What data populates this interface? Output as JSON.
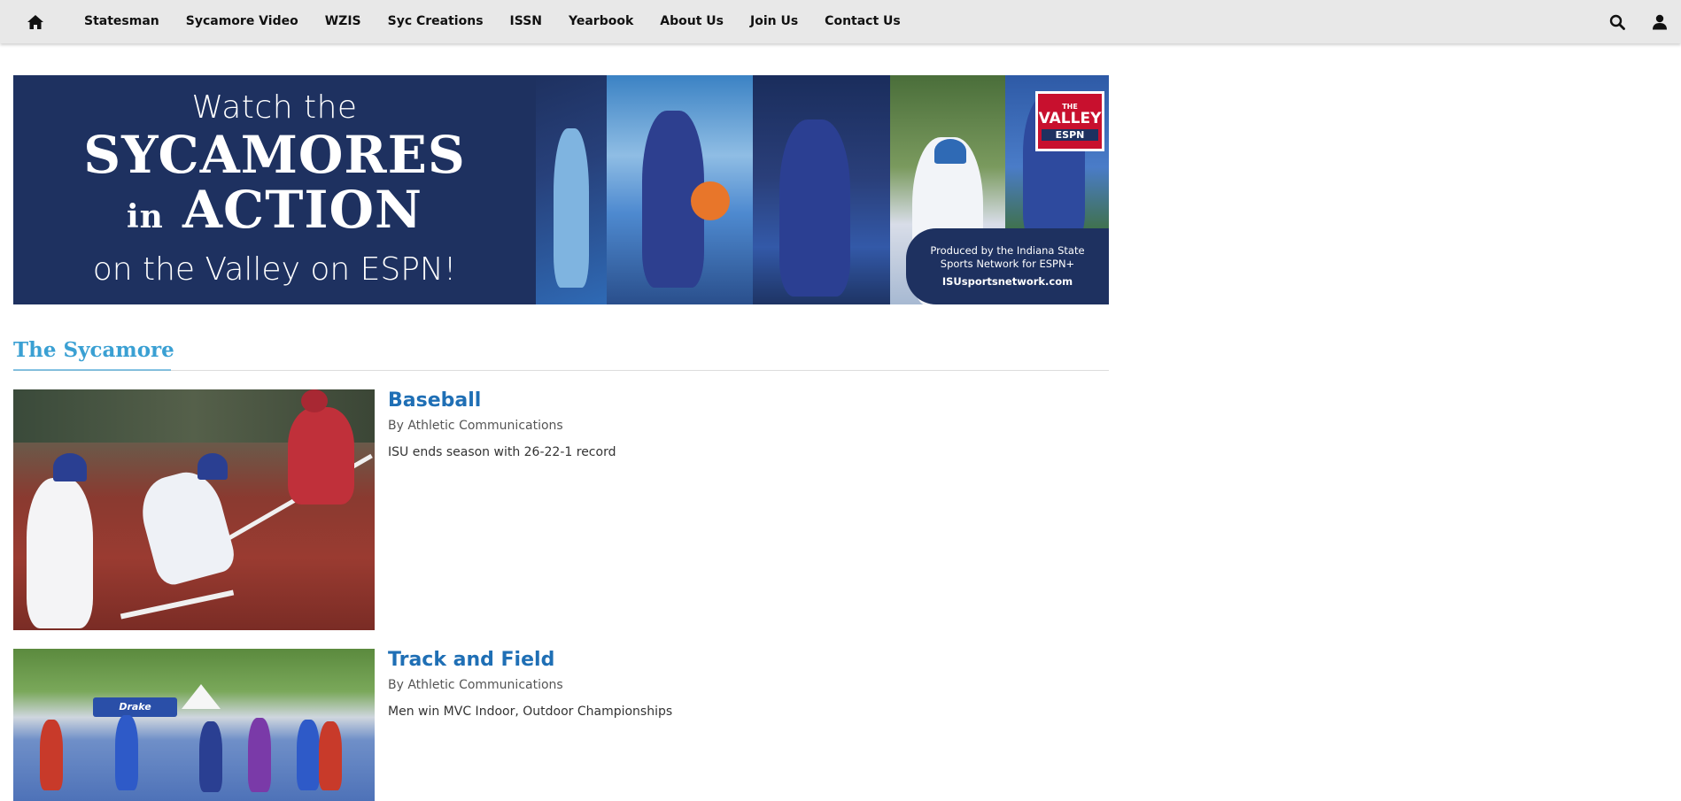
{
  "nav": {
    "home_icon": "home-icon",
    "items": [
      "Statesman",
      "Sycamore Video",
      "WZIS",
      "Syc Creations",
      "ISSN",
      "Yearbook",
      "About Us",
      "Join Us",
      "Contact Us"
    ],
    "search_icon": "search-icon",
    "user_icon": "user-icon"
  },
  "banner": {
    "line1": "Watch the",
    "line2": "SYCAMORES",
    "line3_small": "in",
    "line3_big": "ACTION",
    "line4": "on the Valley on ESPN!",
    "badge_top": "THE",
    "badge_main": "VALLEY",
    "badge_espn": "ESPN",
    "produced_line1": "Produced by the Indiana State",
    "produced_line2": "Sports Network for ESPN+",
    "produced_url": "ISUsportsnetwork.com"
  },
  "section": {
    "title": "The Sycamore"
  },
  "articles": [
    {
      "title": "Baseball",
      "byline": "By Athletic Communications",
      "summary": "ISU ends season with 26-22-1 record"
    },
    {
      "title": "Track and Field",
      "byline": "By Athletic Communications",
      "summary": "Men win MVC Indoor, Outdoor Championships"
    }
  ],
  "colors": {
    "nav_bg": "#e8e8e8",
    "banner_blue": "#1e3160",
    "section_title": "#3aa0d3",
    "article_title": "#1f6fb5"
  }
}
